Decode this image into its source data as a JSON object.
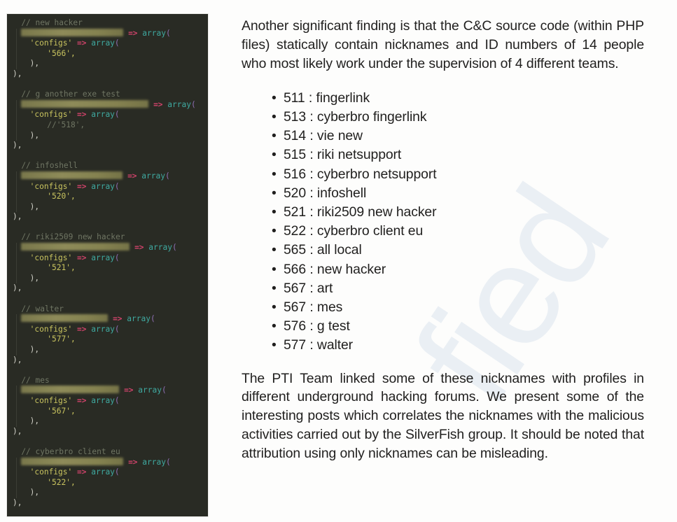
{
  "watermark": {
    "text": "fied"
  },
  "code_panel": {
    "blocks": [
      {
        "comment": "// new hacker",
        "redaction_width": 146,
        "arrow": "=>",
        "fn": "array",
        "open": "(",
        "configs_key": "'configs'",
        "configs_arrow": "=>",
        "configs_fn": "array",
        "configs_open": "(",
        "value": "'566',",
        "close_inner": "),",
        "close_outer": "),"
      },
      {
        "comment": "// g another exe test",
        "redaction_width": 182,
        "arrow": "=>",
        "fn": "array",
        "open": "(",
        "configs_key": "'configs'",
        "configs_arrow": "=>",
        "configs_fn": "array",
        "configs_open": "(",
        "value": "//'518',",
        "value_commented": true,
        "close_inner": "),",
        "close_outer": "),"
      },
      {
        "comment": "// infoshell",
        "redaction_width": 145,
        "arrow": "=>",
        "fn": "array",
        "open": "(",
        "configs_key": "'configs'",
        "configs_arrow": "=>",
        "configs_fn": "array",
        "configs_open": "(",
        "value": "'520',",
        "close_inner": "),",
        "close_outer": "),"
      },
      {
        "comment": "// riki2509 new hacker",
        "redaction_width": 155,
        "arrow": "=>",
        "fn": "array",
        "open": "(",
        "configs_key": "'configs'",
        "configs_arrow": "=>",
        "configs_fn": "array",
        "configs_open": "(",
        "value": "'521',",
        "close_inner": "),",
        "close_outer": "),"
      },
      {
        "comment": "// walter",
        "redaction_width": 124,
        "arrow": "=>",
        "fn": "array",
        "open": "(",
        "configs_key": "'configs'",
        "configs_arrow": "=>",
        "configs_fn": "array",
        "configs_open": "(",
        "value": "'577',",
        "close_inner": "),",
        "close_outer": "),"
      },
      {
        "comment": "// mes",
        "redaction_width": 140,
        "arrow": "=>",
        "fn": "array",
        "open": "(",
        "configs_key": "'configs'",
        "configs_arrow": "=>",
        "configs_fn": "array",
        "configs_open": "(",
        "value": "'567',",
        "close_inner": "),",
        "close_outer": "),"
      },
      {
        "comment": "// cyberbro client eu",
        "redaction_width": 146,
        "arrow": "=>",
        "fn": "array",
        "open": "(",
        "configs_key": "'configs'",
        "configs_arrow": "=>",
        "configs_fn": "array",
        "configs_open": "(",
        "value": "'522',",
        "close_inner": "),",
        "close_outer": "),"
      }
    ]
  },
  "content": {
    "intro_paragraph": "Another significant finding is that the C&C source code (within PHP files) statically contain nicknames and ID numbers of 14 people who most likely work under the supervision of 4 different teams.",
    "bullet_glyph": "•",
    "nicknames": [
      "511 : fingerlink",
      "513 : cyberbro fingerlink",
      "514 : vie new",
      "515 : riki netsupport",
      "516 : cyberbro netsupport",
      "520 : infoshell",
      "521 : riki2509 new hacker",
      "522 : cyberbro client eu",
      "565 : all local",
      "566 : new hacker",
      "567 : art",
      "567 : mes",
      "576 : g test",
      "577 : walter"
    ],
    "outro_paragraph": "The PTI Team linked some of these nicknames with profiles in different underground hacking forums. We present some of the interesting posts which correlates the nicknames with the malicious activities carried out by the SilverFish group. It should be noted that attribution using only nicknames can be misleading."
  },
  "colors": {
    "panel_background": "#292b24",
    "comment": "#6f7563",
    "string": "#c9c45f",
    "arrow": "#d1436b",
    "function": "#3fa9a0",
    "paren": "#8f6fb5",
    "redaction": "#8a8753",
    "body_text": "#201f1e",
    "page_background": "#fdfdfc",
    "watermark": "#eaeff4"
  }
}
